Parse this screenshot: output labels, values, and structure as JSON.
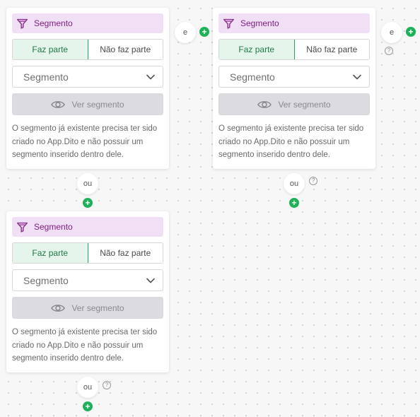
{
  "colors": {
    "header_bg": "#f1dff6",
    "header_text": "#7a1e7e",
    "accent_green": "#1fb15a",
    "active_toggle_bg": "#e6f5ec"
  },
  "icons": {
    "header": "funnel-icon",
    "select": "chevron-down-icon",
    "view": "eye-icon",
    "add": "plus-icon",
    "help": "help-icon"
  },
  "cards": [
    {
      "title": "Segmento",
      "toggle": {
        "active": "Faz parte",
        "inactive": "Não faz parte"
      },
      "select": {
        "value": "Segmento"
      },
      "view_button": "Ver segmento",
      "description": "O segmento já existente precisa ter sido criado no App.Dito e não possuir um segmento inserido dentro dele."
    },
    {
      "title": "Segmento",
      "toggle": {
        "active": "Faz parte",
        "inactive": "Não faz parte"
      },
      "select": {
        "value": "Segmento"
      },
      "view_button": "Ver segmento",
      "description": "O segmento já existente precisa ter sido criado no App.Dito e não possuir um segmento inserido dentro dele."
    },
    {
      "title": "Segmento",
      "toggle": {
        "active": "Faz parte",
        "inactive": "Não faz parte"
      },
      "select": {
        "value": "Segmento"
      },
      "view_button": "Ver segmento",
      "description": "O segmento já existente precisa ter sido criado no App.Dito e não possuir um segmento inserido dentro dele."
    }
  ],
  "connectors": {
    "and_label": "e",
    "or_label": "ou",
    "plus": "+",
    "help": "?"
  }
}
